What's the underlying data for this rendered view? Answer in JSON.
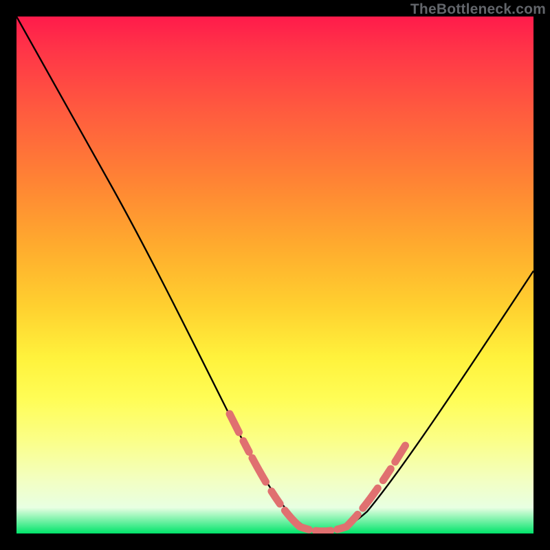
{
  "attribution": "TheBottleneck.com",
  "chart_data": {
    "type": "line",
    "title": "",
    "xlabel": "",
    "ylabel": "",
    "xlim": [
      0,
      100
    ],
    "ylim": [
      0,
      100
    ],
    "grid": false,
    "legend": false,
    "description": "Asymmetric V-shaped bottleneck curve over vertical red-to-green gradient background. Y visually encodes bottleneck percentage (top = 100%, bottom/green band = 0%). Curve has a flat minimum near x ≈ 54–62 and rises more steeply on the left than on the right.",
    "series": [
      {
        "name": "bottleneck-curve",
        "color": "#000000",
        "x": [
          0,
          4,
          8,
          12,
          16,
          20,
          24,
          28,
          32,
          36,
          40,
          44,
          48,
          52,
          56,
          60,
          64,
          68,
          72,
          76,
          80,
          84,
          88,
          92,
          96,
          100
        ],
        "y": [
          100,
          94,
          88,
          81,
          74,
          66,
          58,
          50,
          42,
          34,
          26,
          18,
          10,
          4,
          1,
          0,
          1,
          4,
          9,
          15,
          21,
          27,
          33,
          39,
          45,
          51
        ]
      }
    ],
    "highlight_segments": {
      "description": "Thick salmon dashed/segmented overlay near the valley walls and floor",
      "color": "#e07070",
      "ranges_x": [
        [
          42,
          52
        ],
        [
          52,
          64
        ],
        [
          64,
          72
        ]
      ]
    },
    "gradient_stops": [
      {
        "pos": 0.0,
        "color": "#ff1b4b"
      },
      {
        "pos": 0.18,
        "color": "#ff5a3f"
      },
      {
        "pos": 0.44,
        "color": "#ffaa2e"
      },
      {
        "pos": 0.66,
        "color": "#fff23c"
      },
      {
        "pos": 0.82,
        "color": "#fbff88"
      },
      {
        "pos": 0.95,
        "color": "#e8ffe2"
      },
      {
        "pos": 1.0,
        "color": "#00e46a"
      }
    ]
  }
}
